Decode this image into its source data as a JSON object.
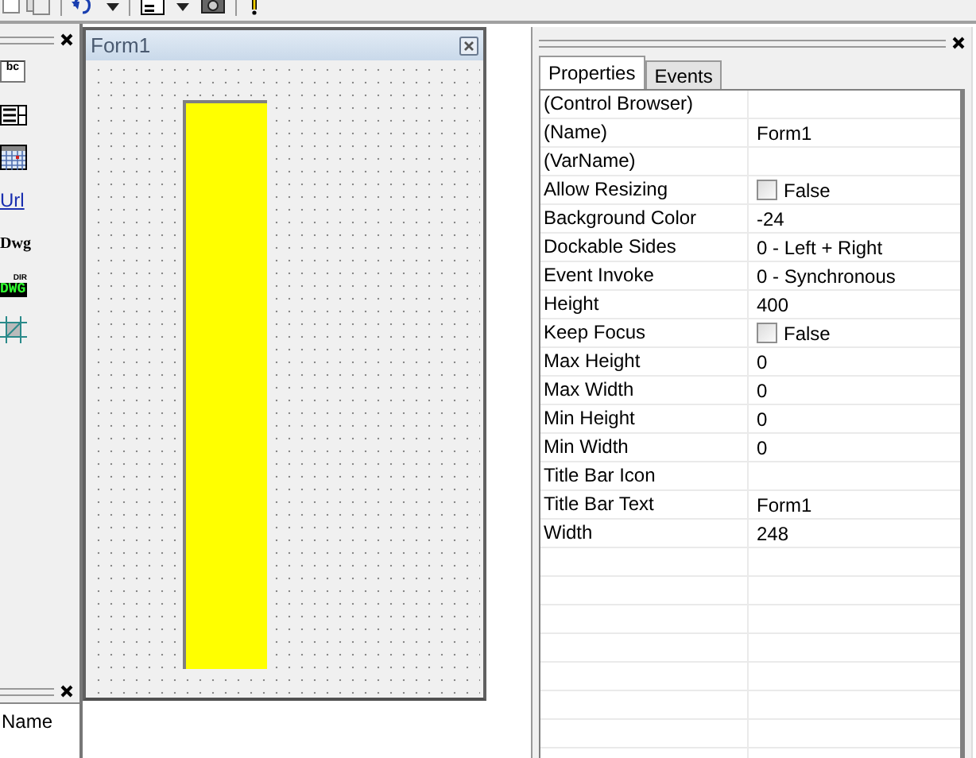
{
  "toolbox": {
    "items": [
      {
        "kind": "textbox",
        "text": "bc"
      },
      {
        "kind": "listbox"
      },
      {
        "kind": "calendar"
      },
      {
        "kind": "link",
        "text": "Url"
      },
      {
        "kind": "bold",
        "text": "Dwg"
      },
      {
        "kind": "badge",
        "text": "DWG",
        "caption": "DIR"
      },
      {
        "kind": "grid"
      }
    ]
  },
  "object_panel": {
    "column": "Name"
  },
  "form": {
    "title": "Form1"
  },
  "properties": {
    "tabs": [
      {
        "label": "Properties",
        "selected": true
      },
      {
        "label": "Events",
        "selected": false
      }
    ],
    "rows": [
      {
        "kind": "text",
        "name": "(Control Browser)"
      },
      {
        "kind": "text",
        "name": "(Name)",
        "value": "Form1"
      },
      {
        "kind": "text",
        "name": "(VarName)"
      },
      {
        "kind": "checkbox",
        "name": "Allow Resizing",
        "value": "False",
        "checked": false
      },
      {
        "kind": "text",
        "name": "Background Color",
        "value": "-24"
      },
      {
        "kind": "text",
        "name": "Dockable Sides",
        "value": "0 - Left + Right"
      },
      {
        "kind": "text",
        "name": "Event Invoke",
        "value": "0 - Synchronous"
      },
      {
        "kind": "text",
        "name": "Height",
        "value": "400"
      },
      {
        "kind": "checkbox",
        "name": "Keep Focus",
        "value": "False",
        "checked": false
      },
      {
        "kind": "text",
        "name": "Max Height",
        "value": "0"
      },
      {
        "kind": "text",
        "name": "Max Width",
        "value": "0"
      },
      {
        "kind": "text",
        "name": "Min Height",
        "value": "0"
      },
      {
        "kind": "text",
        "name": "Min Width",
        "value": "0"
      },
      {
        "kind": "text",
        "name": "Title Bar Icon"
      },
      {
        "kind": "text",
        "name": "Title Bar Text",
        "value": "Form1"
      },
      {
        "kind": "text",
        "name": "Width",
        "value": "248"
      }
    ]
  }
}
